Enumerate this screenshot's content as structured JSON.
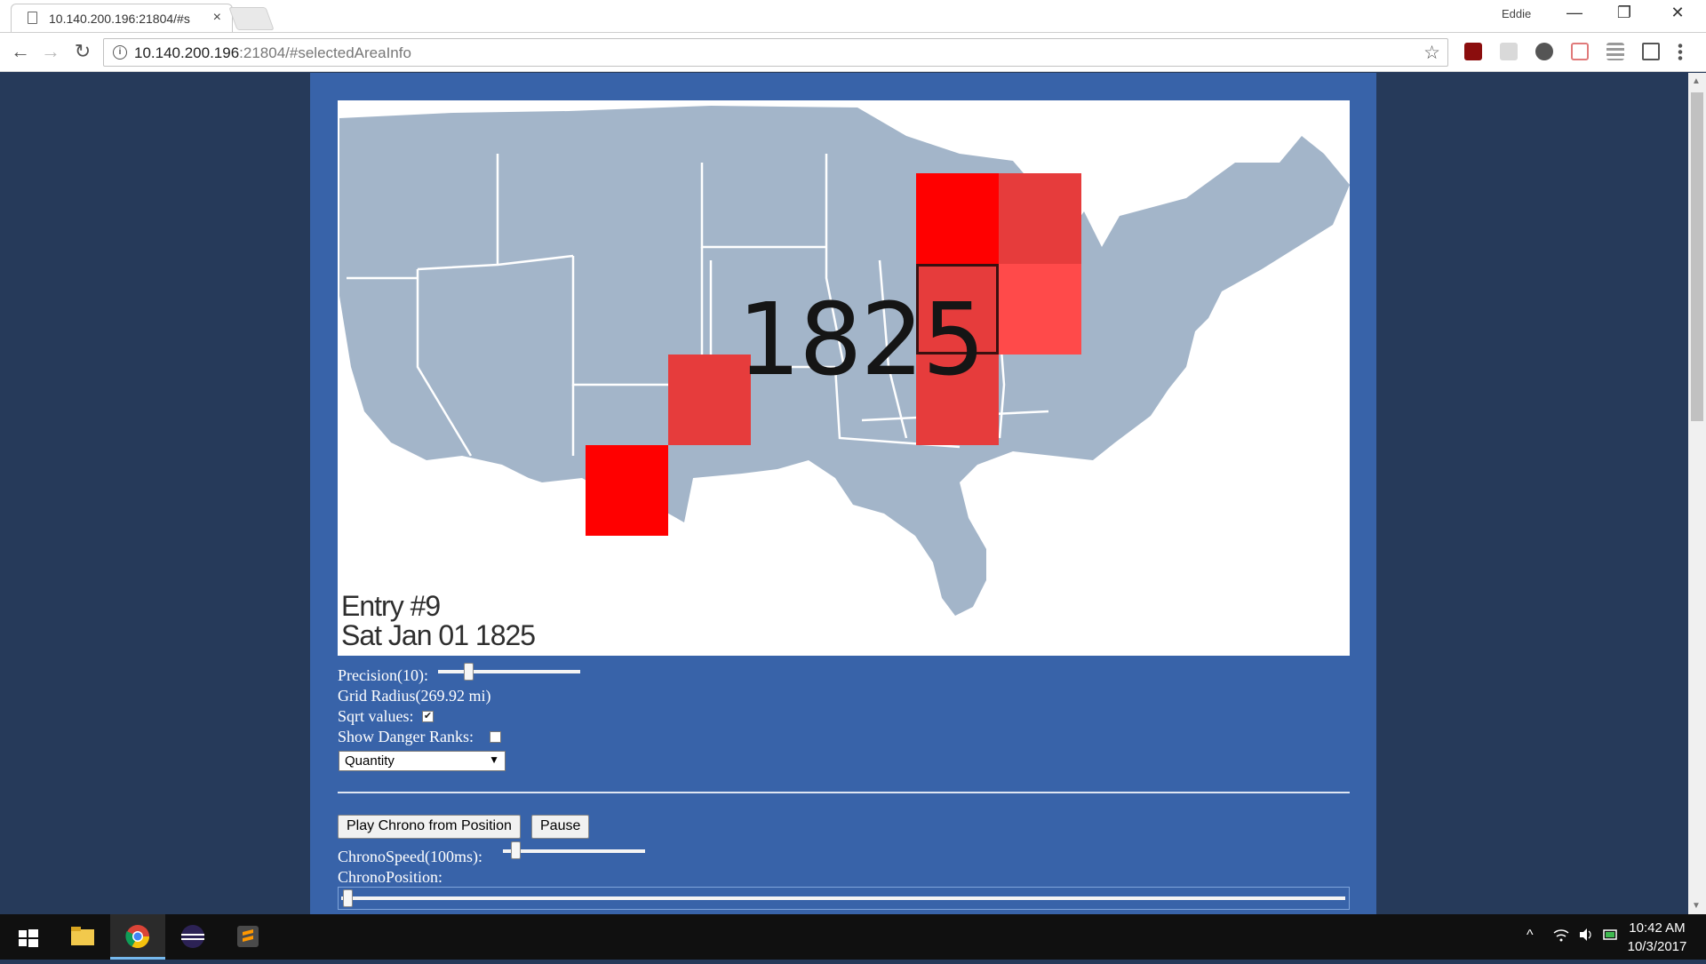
{
  "browser": {
    "tab_title": "10.140.200.196:21804/#s",
    "tab_close": "×",
    "profile_name": "Eddie",
    "url_host": "10.140.200.196",
    "url_rest": ":21804/#selectedAreaInfo",
    "info_glyph": "i",
    "window_controls": {
      "minimize": "—",
      "restore": "❐",
      "close": "✕"
    },
    "nav": {
      "back": "←",
      "forward": "→",
      "reload": "↻"
    },
    "star": "☆",
    "extensions": [
      "ublock-icon",
      "chat-icon",
      "wordpress-icon",
      "reader-icon",
      "stack-icon",
      "cast-icon",
      "menu-icon"
    ]
  },
  "map": {
    "year": "1825",
    "entry": "Entry #9",
    "date": "Sat Jan 01 1825",
    "land_color": "#a3b5c9",
    "cell_colors": {
      "intense": "#ff0000",
      "medium": "#e63c3c",
      "light": "#ff4a4a"
    }
  },
  "controls": {
    "precision_label": "Precision(10):",
    "precision_value": 10,
    "grid_radius_label": "Grid Radius(269.92 mi)",
    "sqrt_label": "Sqrt values:",
    "sqrt_checked": true,
    "sqrt_check_glyph": "✔",
    "danger_label": "Show Danger Ranks:",
    "danger_checked": false,
    "metric_select": "Quantity",
    "select_arrow": "▼",
    "play_button": "Play Chrono from Position",
    "pause_button": "Pause",
    "speed_label": "ChronoSpeed(100ms):",
    "position_label": "ChronoPosition:"
  },
  "taskbar": {
    "apps": [
      "start-icon",
      "file-explorer-icon",
      "chrome-icon",
      "eclipse-icon",
      "sublime-icon"
    ],
    "tray_chevron": "^",
    "time": "10:42 AM",
    "date": "10/3/2017"
  }
}
